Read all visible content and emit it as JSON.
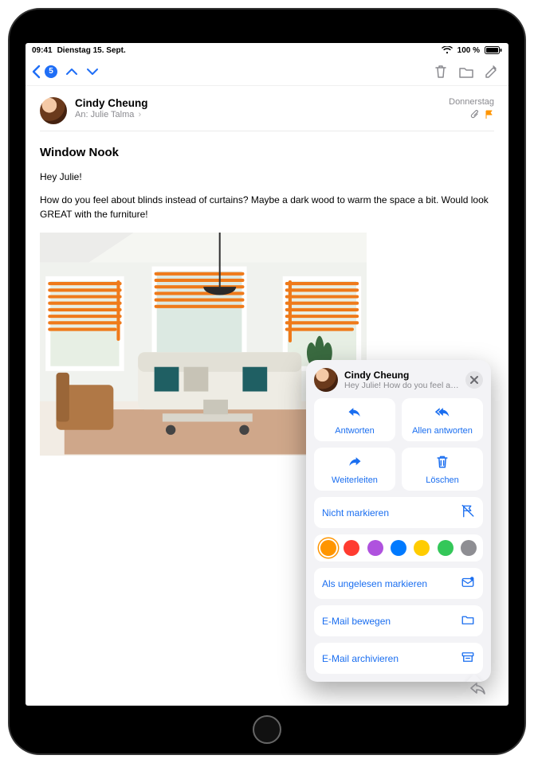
{
  "status": {
    "time": "09:41",
    "date": "Dienstag 15. Sept.",
    "wifi": "wifi-icon",
    "battery_pct": "100 %"
  },
  "toolbar": {
    "unread_count": "5"
  },
  "message": {
    "from": "Cindy Cheung",
    "to_label": "An:",
    "to_name": "Julie Talma",
    "date": "Donnerstag",
    "subject": "Window Nook",
    "greeting": "Hey Julie!",
    "body": "How do you feel about blinds instead of curtains? Maybe a dark wood to warm the space a bit. Would look GREAT with the furniture!"
  },
  "popover": {
    "from": "Cindy Cheung",
    "preview": "Hey Julie! How do you feel ab…",
    "reply": "Antworten",
    "reply_all": "Allen antworten",
    "forward": "Weiterleiten",
    "delete": "Löschen",
    "unflag": "Nicht markieren",
    "mark_unread": "Als ungelesen markieren",
    "move": "E-Mail bewegen",
    "archive": "E-Mail archivieren"
  },
  "flag_colors": [
    "#ff9500",
    "#ff3b30",
    "#af52de",
    "#007aff",
    "#ffcc00",
    "#34c759",
    "#8e8e93"
  ]
}
